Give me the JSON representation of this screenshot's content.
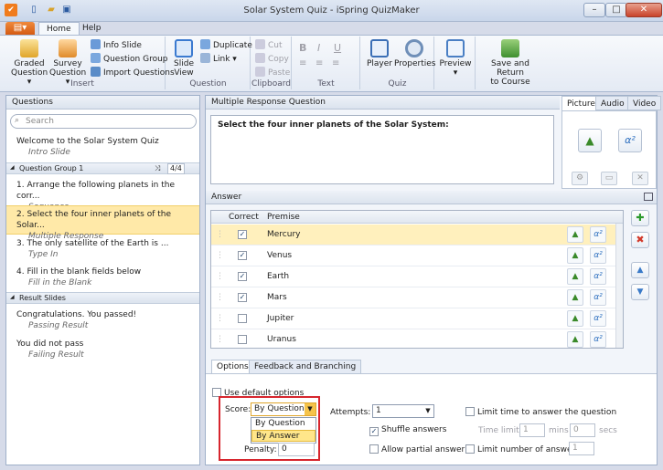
{
  "window": {
    "title": "Solar System Quiz - iSpring QuizMaker",
    "minimize": "–",
    "maximize": "□",
    "close": "✕"
  },
  "tabs": [
    "Home",
    "Help"
  ],
  "ribbon": {
    "insert": {
      "label": "Insert",
      "graded": "Graded\nQuestion ▾",
      "survey": "Survey\nQuestion ▾",
      "info_slide": "Info Slide",
      "question_group": "Question Group",
      "import_questions": "Import Questions"
    },
    "question": {
      "label": "Question",
      "slide_view": "Slide\nView",
      "duplicate": "Duplicate",
      "link": "Link ▾"
    },
    "clipboard": {
      "label": "Clipboard",
      "cut": "Cut",
      "copy": "Copy",
      "paste": "Paste"
    },
    "text": {
      "label": "Text",
      "bold": "B",
      "italic": "I",
      "underline": "U"
    },
    "quiz": {
      "label": "Quiz",
      "player": "Player",
      "properties": "Properties"
    },
    "preview": "Preview\n▾",
    "save": "Save and Return\nto Course"
  },
  "questions_panel": {
    "title": "Questions",
    "search_placeholder": "Search",
    "items": [
      {
        "title": "Welcome to the Solar System Quiz",
        "type": "Intro Slide"
      },
      {
        "title": "1. Arrange the following planets in the corr...",
        "type": "Sequence"
      },
      {
        "title": "2. Select the four inner planets of the Solar...",
        "type": "Multiple Response"
      },
      {
        "title": "3. The only satellite of the Earth is ...",
        "type": "Type In"
      },
      {
        "title": "4. Fill in the blank fields below",
        "type": "Fill in the Blank"
      },
      {
        "title": "Congratulations. You passed!",
        "type": "Passing Result"
      },
      {
        "title": "You did not pass",
        "type": "Failing Result"
      }
    ],
    "group": {
      "label": "Question Group 1",
      "count": "4/4"
    },
    "result_header": "Result Slides"
  },
  "question_editor": {
    "header": "Multiple Response Question",
    "question_text": "Select the four inner planets of the Solar System:",
    "media_tabs": [
      "Picture",
      "Audio",
      "Video"
    ]
  },
  "answer": {
    "header": "Answer",
    "columns": [
      "Correct",
      "Premise"
    ],
    "rows": [
      {
        "premise": "Mercury",
        "correct": true
      },
      {
        "premise": "Venus",
        "correct": true
      },
      {
        "premise": "Earth",
        "correct": true
      },
      {
        "premise": "Mars",
        "correct": true
      },
      {
        "premise": "Jupiter",
        "correct": false
      },
      {
        "premise": "Uranus",
        "correct": false
      }
    ]
  },
  "options": {
    "tabs": [
      "Options",
      "Feedback and Branching"
    ],
    "use_default": "Use default options",
    "score_label": "Score:",
    "score_value": "By Question",
    "score_options": [
      "By Question",
      "By Answer"
    ],
    "penalty_label": "Penalty:",
    "penalty_value": "0",
    "attempts_label": "Attempts:",
    "attempts_value": "1",
    "shuffle": "Shuffle answers",
    "partial": "Allow partial answer",
    "limit_time": "Limit time to answer the question",
    "time_limit_label": "Time limit:",
    "mins_value": "1",
    "mins_label": "mins",
    "secs_value": "0",
    "secs_label": "secs",
    "limit_answers": "Limit number of answers:",
    "answers_value": "1"
  },
  "colors": {
    "accent": "#f2cf6a",
    "highlight_box": "#d7262e"
  }
}
